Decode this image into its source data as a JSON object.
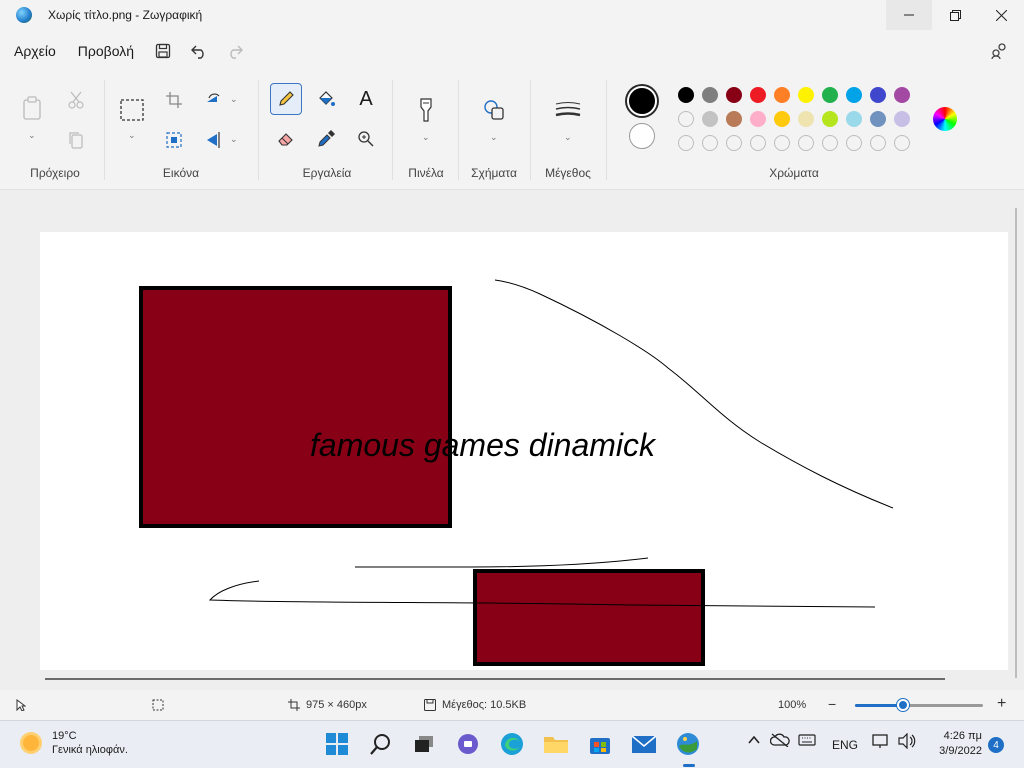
{
  "window": {
    "title": "Χωρίς τίτλο.png - Ζωγραφική",
    "minimize_icon": "minimize-icon",
    "maximize_icon": "restore-icon",
    "close_icon": "close-icon"
  },
  "menu": {
    "file": "Αρχείο",
    "view": "Προβολή",
    "save_icon": "save-icon",
    "undo_icon": "undo-icon",
    "redo_icon": "redo-icon",
    "share_icon": "share-icon"
  },
  "ribbon": {
    "groups": {
      "clipboard": "Πρόχειρο",
      "image": "Εικόνα",
      "tools": "Εργαλεία",
      "brushes": "Πινέλα",
      "shapes": "Σχήματα",
      "size": "Μέγεθος",
      "colors": "Χρώματα"
    },
    "text_tool_glyph": "A"
  },
  "colors": {
    "primary": "#000000",
    "secondary": "#ffffff",
    "palette_row1": [
      "#000000",
      "#7f7f7f",
      "#880015",
      "#ed1c24",
      "#ff7f27",
      "#fff200",
      "#22b14c",
      "#00a2e8",
      "#3f48cc",
      "#a349a4"
    ],
    "palette_row2": [
      "#ffffff",
      "#c3c3c3",
      "#b97a57",
      "#ffaec9",
      "#ffc90e",
      "#efe4b0",
      "#b5e61d",
      "#99d9ea",
      "#7092be",
      "#c8bfe7"
    ],
    "accent": "#1f6fc7"
  },
  "canvas": {
    "text": "famous games dinamick",
    "rect_fill": "#880015",
    "rect_stroke": "#000000"
  },
  "status": {
    "dimensions": "975 × 460px",
    "size": "Μέγεθος: 10.5KB",
    "zoom": "100%",
    "zoom_minus": "−",
    "zoom_plus": "+"
  },
  "taskbar": {
    "temperature": "19°C",
    "weather_desc": "Γενικά ηλιοφάν.",
    "language": "ENG",
    "time": "4:26 πμ",
    "date": "3/9/2022",
    "notifications": "4"
  }
}
